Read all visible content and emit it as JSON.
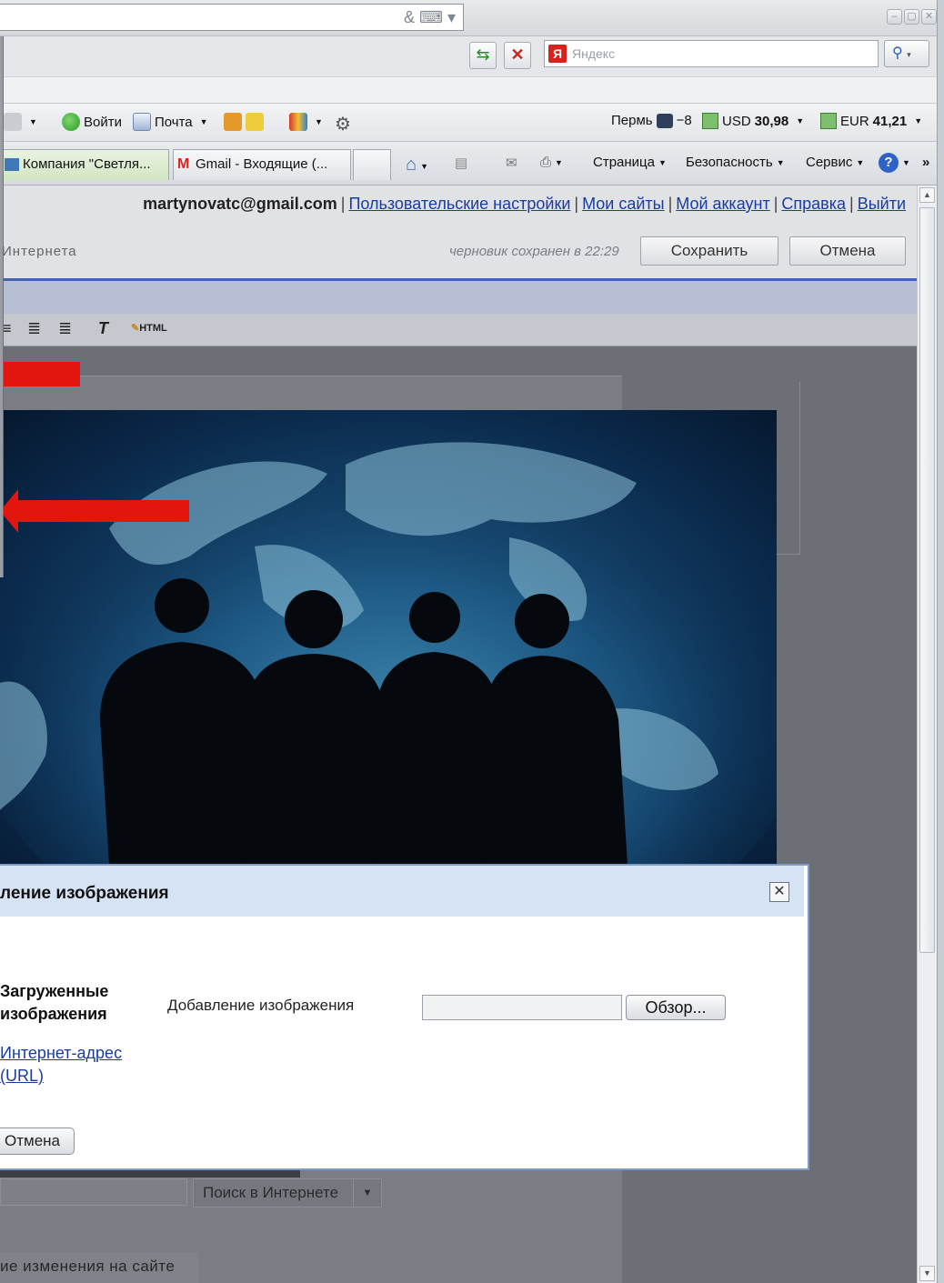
{
  "window": {
    "controls": [
      "–",
      "▢",
      "✕"
    ]
  },
  "yandex_search": {
    "placeholder": "Яндекс",
    "logo": "Я"
  },
  "toolbar": {
    "login": "Войти",
    "mail": "Почта",
    "weather_city": "Пермь",
    "weather_temp": "−8",
    "usd_label": "USD",
    "usd_value": "30,98",
    "eur_label": "EUR",
    "eur_value": "41,21"
  },
  "tabs": [
    {
      "label": "Компания \"Светля..."
    },
    {
      "label": "Gmail - Входящие (..."
    }
  ],
  "commands": {
    "page": "Страница",
    "security": "Безопасность",
    "service": "Сервис",
    "more": "»"
  },
  "header": {
    "email": "martynovatc@gmail.com",
    "links": [
      "Пользовательские настройки",
      "Мои сайты",
      "Мой аккаунт",
      "Справка",
      "Выйти"
    ],
    "blog_title": "Интернета",
    "draft_note": "черновик сохранен в 22:29",
    "save": "Сохранить",
    "cancel": "Отмена"
  },
  "editor": {
    "html_label": "HTML"
  },
  "dialog": {
    "title": "ление изображения",
    "close": "✕",
    "uploaded_line1": "Загруженные",
    "uploaded_line2": "изображения",
    "url_line1": "Интернет-адрес",
    "url_line2": "(URL)",
    "field_label": "Добавление изображения",
    "browse": "Обзор...",
    "cancel": "Отмена"
  },
  "below": {
    "search_button": "Поиск в Интернете",
    "bottom_link": "ие изменения на сайте"
  }
}
